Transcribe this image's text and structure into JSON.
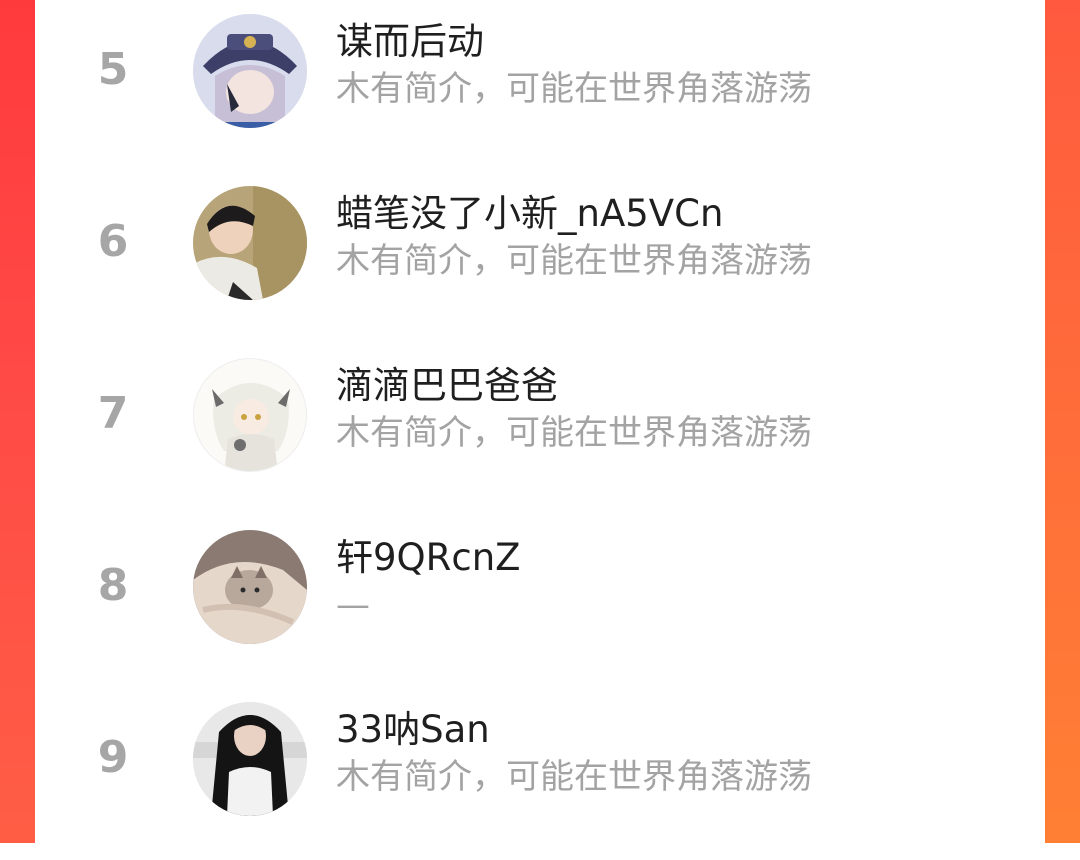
{
  "leaderboard": {
    "entries": [
      {
        "rank": "5",
        "name": "谋而后动",
        "bio": "木有简介，可能在世界角落游荡",
        "avatar_icon": "anime-character-avatar"
      },
      {
        "rank": "6",
        "name": "蜡笔没了小新_nA5VCn",
        "bio": "木有简介，可能在世界角落游荡",
        "avatar_icon": "boy-photo-avatar"
      },
      {
        "rank": "7",
        "name": "滴滴巴巴爸爸",
        "bio": "木有简介，可能在世界角落游荡",
        "avatar_icon": "anime-character-avatar"
      },
      {
        "rank": "8",
        "name": "轩9QRcnZ",
        "bio": "—",
        "avatar_icon": "cat-photo-avatar"
      },
      {
        "rank": "9",
        "name": "33呐San",
        "bio": "木有简介，可能在世界角落游荡",
        "avatar_icon": "girl-photo-avatar"
      }
    ]
  },
  "colors": {
    "edge_left": "#ff4444",
    "edge_right": "#ff7038",
    "rank_text": "#a6a6a6",
    "name_text": "#1f1f1f",
    "bio_text": "#a3a3a3"
  }
}
